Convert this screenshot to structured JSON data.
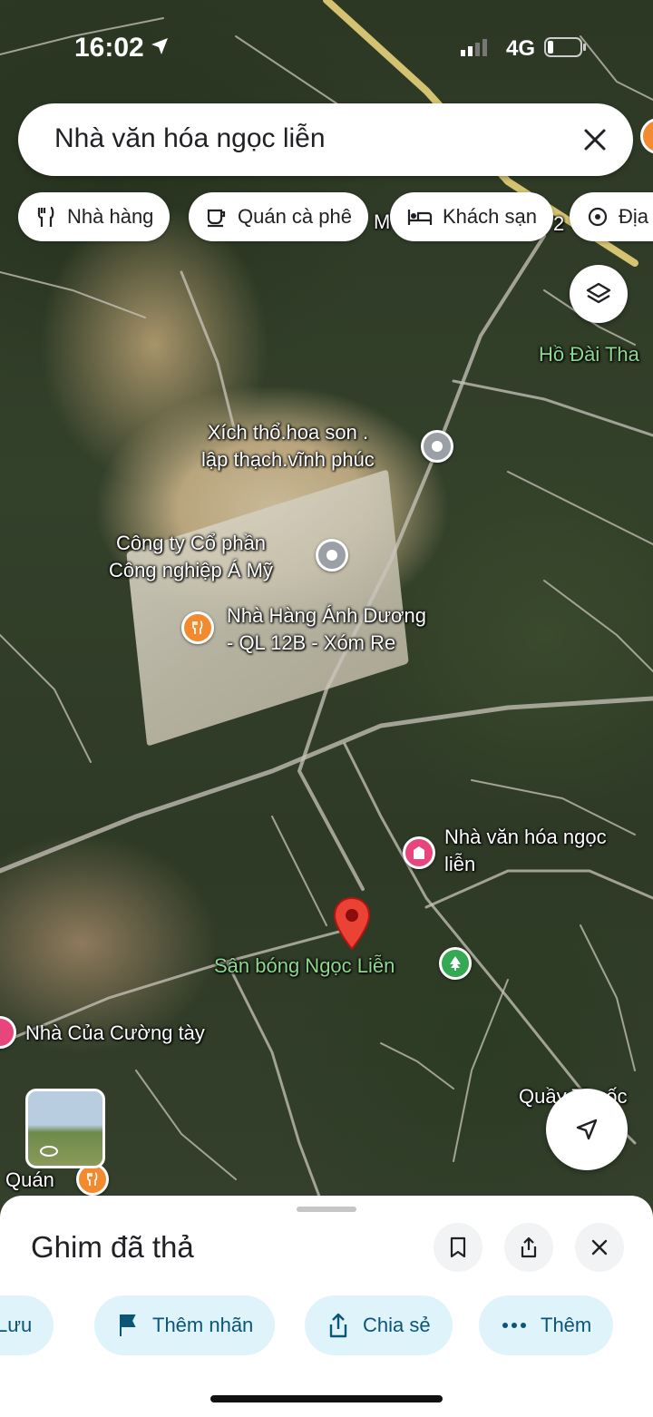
{
  "status_bar": {
    "time": "16:02",
    "network": "4G"
  },
  "search": {
    "query": "Nhà văn hóa ngọc liễn"
  },
  "chips": [
    {
      "label": "Nhà hàng",
      "icon": "restaurant-icon"
    },
    {
      "label": "Quán cà phê",
      "icon": "coffee-icon"
    },
    {
      "label": "Khách sạn",
      "icon": "hotel-icon"
    },
    {
      "label": "Địa",
      "icon": "attraction-icon"
    }
  ],
  "map": {
    "labels": {
      "ho_dai": "Hồ Đài Tha",
      "xich_tho": "Xích thổ.hoa son .\nlập thạch.vĩnh phúc",
      "cong_ty": "Công ty Cổ phần\nCông nghiệp Á Mỹ",
      "nha_hang": "Nhà Hàng Ánh Dương\n- QL 12B - Xóm Re",
      "nha_van_hoa": "Nhà văn hóa ngọc\nliễn",
      "san_bong": "Sân bóng Ngọc Liễn",
      "nha_cua": "Nhà Của Cường tày",
      "quan_bottom": "Quán",
      "quan_thuoc": "Quầy Thuốc",
      "partial_m": "M",
      "partial_2": "2"
    },
    "colors": {
      "pin_red": "#ea4335",
      "poi_gray": "#9aa0a6",
      "poi_orange": "#f28b30",
      "poi_pink": "#e8457c",
      "poi_green": "#34a853",
      "road": "#c9c4bb",
      "highway": "#e8d17a"
    }
  },
  "sheet": {
    "title": "Ghim đã thả",
    "actions": [
      {
        "label": "Lưu",
        "icon": "bookmark-icon"
      },
      {
        "label": "Thêm nhãn",
        "icon": "flag-icon"
      },
      {
        "label": "Chia sẻ",
        "icon": "share-icon"
      },
      {
        "label": "Thêm",
        "icon": "more-icon"
      }
    ]
  }
}
